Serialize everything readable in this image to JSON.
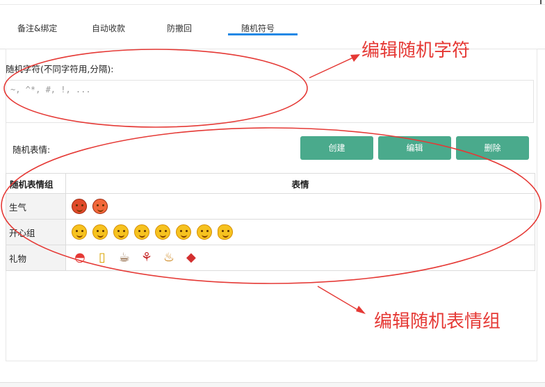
{
  "tabs": [
    {
      "label": "备注&绑定"
    },
    {
      "label": "自动收款"
    },
    {
      "label": "防撤回"
    },
    {
      "label": "随机符号"
    }
  ],
  "active_tab": "随机符号",
  "random_chars": {
    "label": "随机字符(不同字符用,分隔):",
    "placeholder": "~, ^*, #, !, ..."
  },
  "random_emoji": {
    "label": "随机表情:",
    "buttons": {
      "create": "创建",
      "edit": "编辑",
      "delete": "删除"
    },
    "accent_color": "#4aaa8c"
  },
  "table": {
    "headers": [
      "随机表情组",
      "表情"
    ],
    "rows": [
      {
        "group": "生气",
        "emojis": [
          "angry-face-icon",
          "pouting-face-icon"
        ]
      },
      {
        "group": "开心组",
        "emojis": [
          "smile-face-icon",
          "heart-eyes-face-icon",
          "grin-face-icon",
          "big-smile-face-icon",
          "thinking-face-icon",
          "laughing-face-icon",
          "shy-smile-face-icon",
          "fist-bump-icon"
        ]
      },
      {
        "group": "礼物",
        "emojis": [
          "watermelon-icon",
          "beer-icon",
          "coffee-icon",
          "rose-icon",
          "cake-icon",
          "fortune-icon"
        ]
      }
    ]
  },
  "annotations": {
    "top": "编辑随机字符",
    "bottom": "编辑随机表情组",
    "color": "#e53935"
  }
}
